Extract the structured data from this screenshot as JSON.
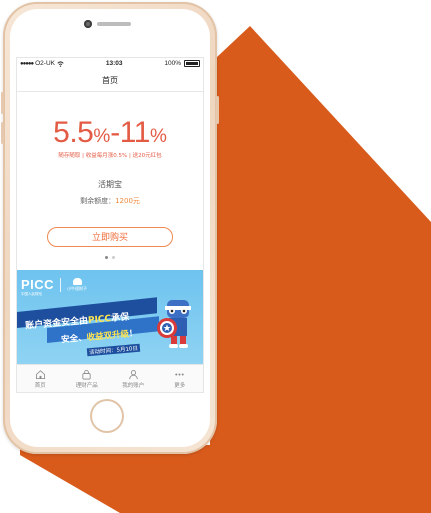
{
  "status_bar": {
    "carrier": "O2-UK",
    "time": "13:03",
    "battery": "100%"
  },
  "nav": {
    "title": "首页"
  },
  "product": {
    "rate_low": "5.5",
    "rate_high": "11",
    "rate_percent": "%",
    "rate_dash": "-",
    "promo": "随存随取 | 收益每月涨0.5% | 送20元红包",
    "name": "活期宝",
    "remaining_label": "剩余额度：",
    "remaining_amount": "1200元",
    "buy_label": "立即购买"
  },
  "carousel": {
    "page_count": 2,
    "active_index": 0
  },
  "banner": {
    "logo": "PICC",
    "logo_sub": "中国人民财险",
    "partner_name": "小牛理财子",
    "line1_a": "账户资金安全由",
    "line1_hl": "PICC",
    "line1_b": "承保",
    "line2_a": "安全、",
    "line2_hl": "收益双升级",
    "line2_b": "！",
    "line3": "活动时间：5月10日"
  },
  "tabs": [
    {
      "label": "首页",
      "icon": "home-icon"
    },
    {
      "label": "理财产品",
      "icon": "lock-icon"
    },
    {
      "label": "我的账户",
      "icon": "user-icon"
    },
    {
      "label": "更多",
      "icon": "more-icon"
    }
  ],
  "colors": {
    "accent": "#e35b44",
    "button": "#ef6b3a",
    "banner": "#6ec3ef",
    "shadow": "#d95b1c"
  }
}
